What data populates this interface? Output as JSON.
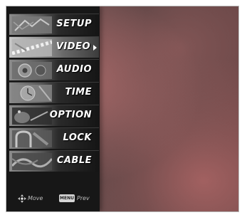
{
  "menu": {
    "items": [
      {
        "label": "SETUP",
        "selected": false,
        "icon": "setup-thumbnail-icon"
      },
      {
        "label": "VIDEO",
        "selected": true,
        "icon": "video-thumbnail-icon"
      },
      {
        "label": "AUDIO",
        "selected": false,
        "icon": "audio-thumbnail-icon"
      },
      {
        "label": "TIME",
        "selected": false,
        "icon": "time-thumbnail-icon"
      },
      {
        "label": "OPTION",
        "selected": false,
        "icon": "option-thumbnail-icon"
      },
      {
        "label": "LOCK",
        "selected": false,
        "icon": "lock-thumbnail-icon"
      },
      {
        "label": "CABLE",
        "selected": false,
        "icon": "cable-thumbnail-icon"
      }
    ],
    "selected_indicator": "right-arrow-icon"
  },
  "footer": {
    "move_label": "Move",
    "move_icon": "directional-pad-icon",
    "menu_key_label": "MENU",
    "prev_label": "Prev"
  },
  "colors": {
    "menu_background": "#171717",
    "selected_item": "#c7c7c7",
    "label_text": "#ffffff",
    "background_tint": "#6d4f4f"
  }
}
